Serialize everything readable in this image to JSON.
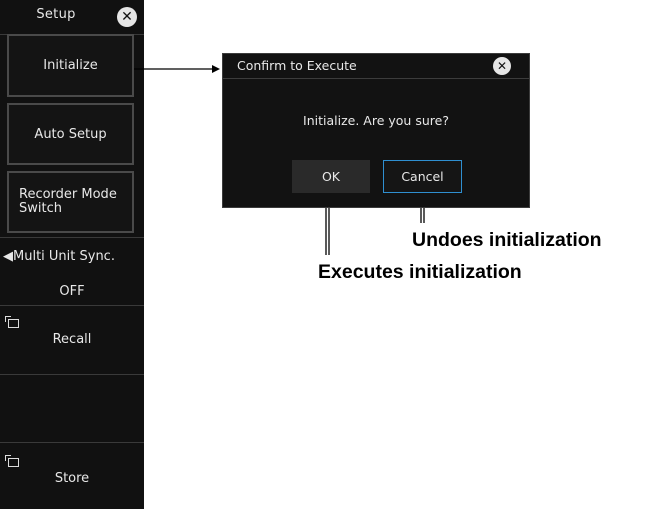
{
  "menu": {
    "title": "Setup",
    "close_icon": "close-icon",
    "items": {
      "initialize": "Initialize",
      "auto_setup": "Auto Setup",
      "recorder_mode_switch": "Recorder Mode Switch",
      "multi_unit_sync_label": "◀Multi Unit Sync.",
      "multi_unit_sync_value": "OFF",
      "recall": "Recall",
      "store": "Store"
    }
  },
  "dialog": {
    "title": "Confirm to Execute",
    "message": "Initialize. Are you sure?",
    "ok_label": "OK",
    "cancel_label": "Cancel"
  },
  "annotations": {
    "cancel_note": "Undoes initialization",
    "ok_note": "Executes initialization"
  },
  "colors": {
    "menu_background": "#111111",
    "dialog_background": "#121212",
    "cancel_focus_border": "#2f8fd0",
    "text": "#e8e8e8"
  }
}
